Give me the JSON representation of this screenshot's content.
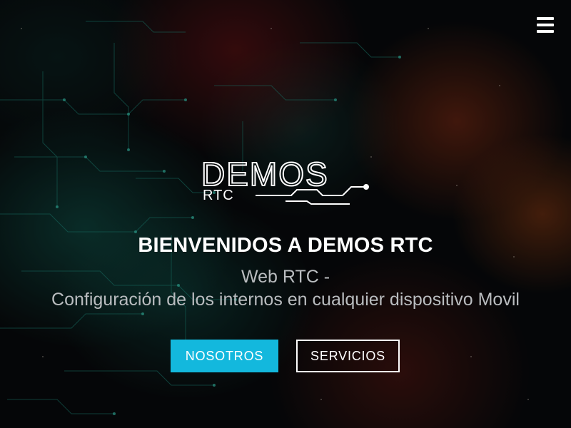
{
  "header": {
    "menu_icon": "hamburger-menu-icon"
  },
  "logo": {
    "brand_main": "DEMOS",
    "brand_sub": "RTC"
  },
  "hero": {
    "title": "BIENVENIDOS A DEMOS RTC",
    "subtitle_line1": "Web RTC -",
    "subtitle_line2": "Configuración de los internos en cualquier dispositivo Movil"
  },
  "buttons": {
    "primary_label": "NOSOTROS",
    "secondary_label": "SERVICIOS"
  },
  "colors": {
    "accent": "#13b8dd",
    "text": "#ffffff",
    "subtitle": "#b9bcbf"
  }
}
